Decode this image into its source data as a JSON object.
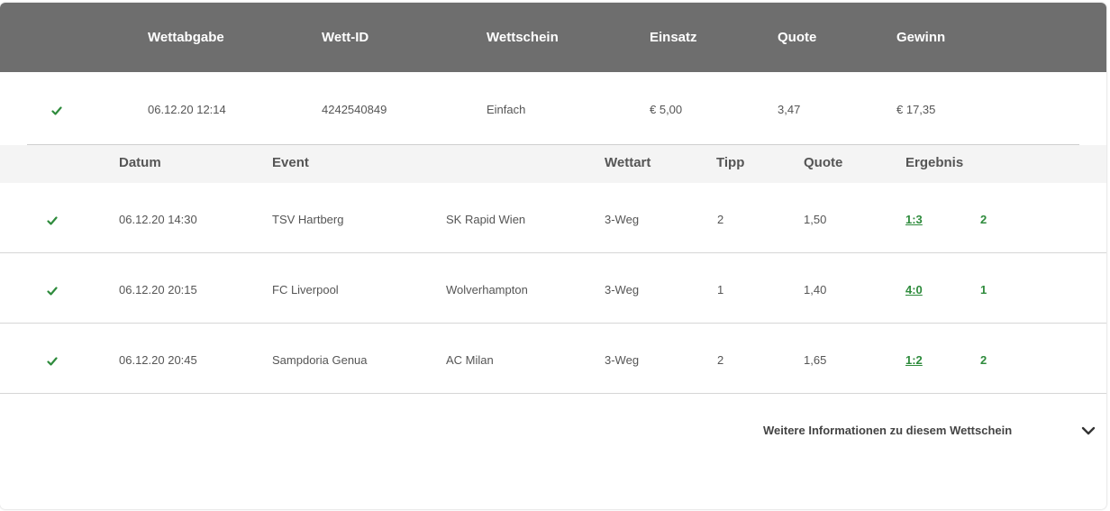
{
  "header": {
    "columns": [
      "Wettabgabe",
      "Wett-ID",
      "Wettschein",
      "Einsatz",
      "Quote",
      "Gewinn"
    ]
  },
  "summary": {
    "status_icon": "check-icon",
    "date": "06.12.20 12:14",
    "bet_id": "4242540849",
    "slip_type": "Einfach",
    "stake": "€ 5,00",
    "odds": "3,47",
    "winnings": "€ 17,35"
  },
  "details": {
    "columns": [
      "Datum",
      "Event",
      "Wettart",
      "Tipp",
      "Quote",
      "Ergebnis"
    ],
    "rows": [
      {
        "status_icon": "check-icon",
        "date": "06.12.20 14:30",
        "home": "TSV Hartberg",
        "away": "SK Rapid Wien",
        "bet_type": "3-Weg",
        "tip": "2",
        "odds": "1,50",
        "score": "1:3",
        "outcome": "2"
      },
      {
        "status_icon": "check-icon",
        "date": "06.12.20 20:15",
        "home": "FC Liverpool",
        "away": "Wolverhampton",
        "bet_type": "3-Weg",
        "tip": "1",
        "odds": "1,40",
        "score": "4:0",
        "outcome": "1"
      },
      {
        "status_icon": "check-icon",
        "date": "06.12.20 20:45",
        "home": "Sampdoria Genua",
        "away": "AC Milan",
        "bet_type": "3-Weg",
        "tip": "2",
        "odds": "1,65",
        "score": "1:2",
        "outcome": "2"
      }
    ]
  },
  "footer": {
    "more_info_label": "Weitere Informationen zu diesem Wettschein",
    "toggle_icon": "chevron-down-icon"
  },
  "colors": {
    "header_bg": "#6e6e6e",
    "subheader_bg": "#f4f4f4",
    "success_green": "#2e8b3c"
  }
}
